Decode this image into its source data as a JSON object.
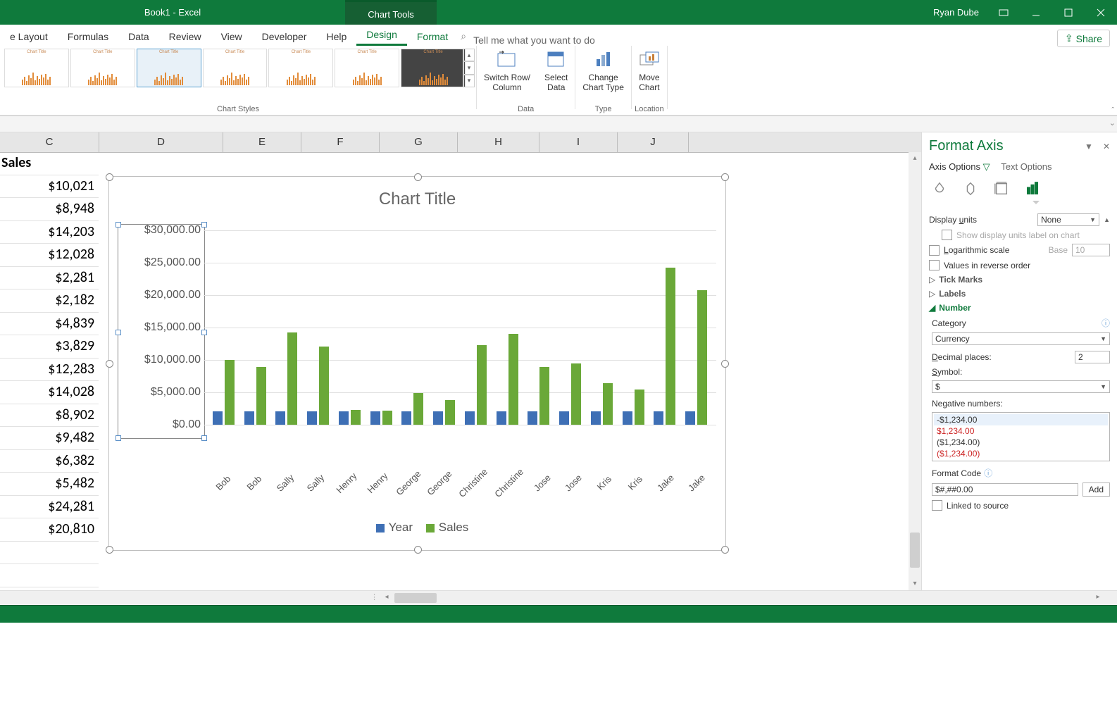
{
  "titlebar": {
    "doc": "Book1 - Excel",
    "context": "Chart Tools",
    "user": "Ryan Dube"
  },
  "tabs": {
    "layout": "e Layout",
    "formulas": "Formulas",
    "data": "Data",
    "review": "Review",
    "view": "View",
    "developer": "Developer",
    "help": "Help",
    "design": "Design",
    "format": "Format",
    "tell": "Tell me what you want to do",
    "share": "Share"
  },
  "ribbon": {
    "styles_label": "Chart Styles",
    "switch": "Switch Row/\nColumn",
    "select": "Select\nData",
    "change": "Change\nChart Type",
    "move": "Move\nChart",
    "data_label": "Data",
    "type_label": "Type",
    "loc_label": "Location",
    "thumb_title": "Chart Title"
  },
  "grid": {
    "cols": [
      "C",
      "D",
      "E",
      "F",
      "G",
      "H",
      "I",
      "J"
    ],
    "header": "Sales",
    "values": [
      "$10,021",
      "$8,948",
      "$14,203",
      "$12,028",
      "$2,281",
      "$2,182",
      "$4,839",
      "$3,829",
      "$12,283",
      "$14,028",
      "$8,902",
      "$9,482",
      "$6,382",
      "$5,482",
      "$24,281",
      "$20,810"
    ]
  },
  "chart_data": {
    "type": "bar",
    "title": "Chart Title",
    "ylabel": "",
    "ylim": [
      0,
      30000
    ],
    "yticks": [
      "$30,000.00",
      "$25,000.00",
      "$20,000.00",
      "$15,000.00",
      "$10,000.00",
      "$5,000.00",
      "$0.00"
    ],
    "categories": [
      "Bob",
      "Bob",
      "Sally",
      "Sally",
      "Henry",
      "Henry",
      "George",
      "George",
      "Christine",
      "Christine",
      "Jose",
      "Jose",
      "Kris",
      "Kris",
      "Jake",
      "Jake"
    ],
    "series": [
      {
        "name": "Year",
        "color": "#3e6fb5",
        "values": [
          2018,
          2019,
          2018,
          2019,
          2018,
          2019,
          2018,
          2019,
          2018,
          2019,
          2018,
          2019,
          2018,
          2019,
          2018,
          2019
        ]
      },
      {
        "name": "Sales",
        "color": "#6aa838",
        "values": [
          10021,
          8948,
          14203,
          12028,
          2281,
          2182,
          4839,
          3829,
          12283,
          14028,
          8902,
          9482,
          6382,
          5482,
          24281,
          20810
        ]
      }
    ]
  },
  "pane": {
    "title": "Format Axis",
    "axis_options": "Axis Options",
    "text_options": "Text Options",
    "display_units": "Display units",
    "display_units_val": "None",
    "show_units": "Show display units label on chart",
    "log": "Logarithmic scale",
    "base": "Base",
    "base_val": "10",
    "reverse": "Values in reverse order",
    "tick": "Tick Marks",
    "labels": "Labels",
    "number": "Number",
    "category": "Category",
    "category_val": "Currency",
    "decimal": "Decimal places:",
    "decimal_val": "2",
    "symbol": "Symbol:",
    "symbol_val": "$",
    "neg": "Negative numbers:",
    "neg_opts": [
      "-$1,234.00",
      "$1,234.00",
      "($1,234.00)",
      "($1,234.00)"
    ],
    "format_code": "Format Code",
    "format_code_val": "$#,##0.00",
    "add": "Add",
    "linked": "Linked to source"
  }
}
